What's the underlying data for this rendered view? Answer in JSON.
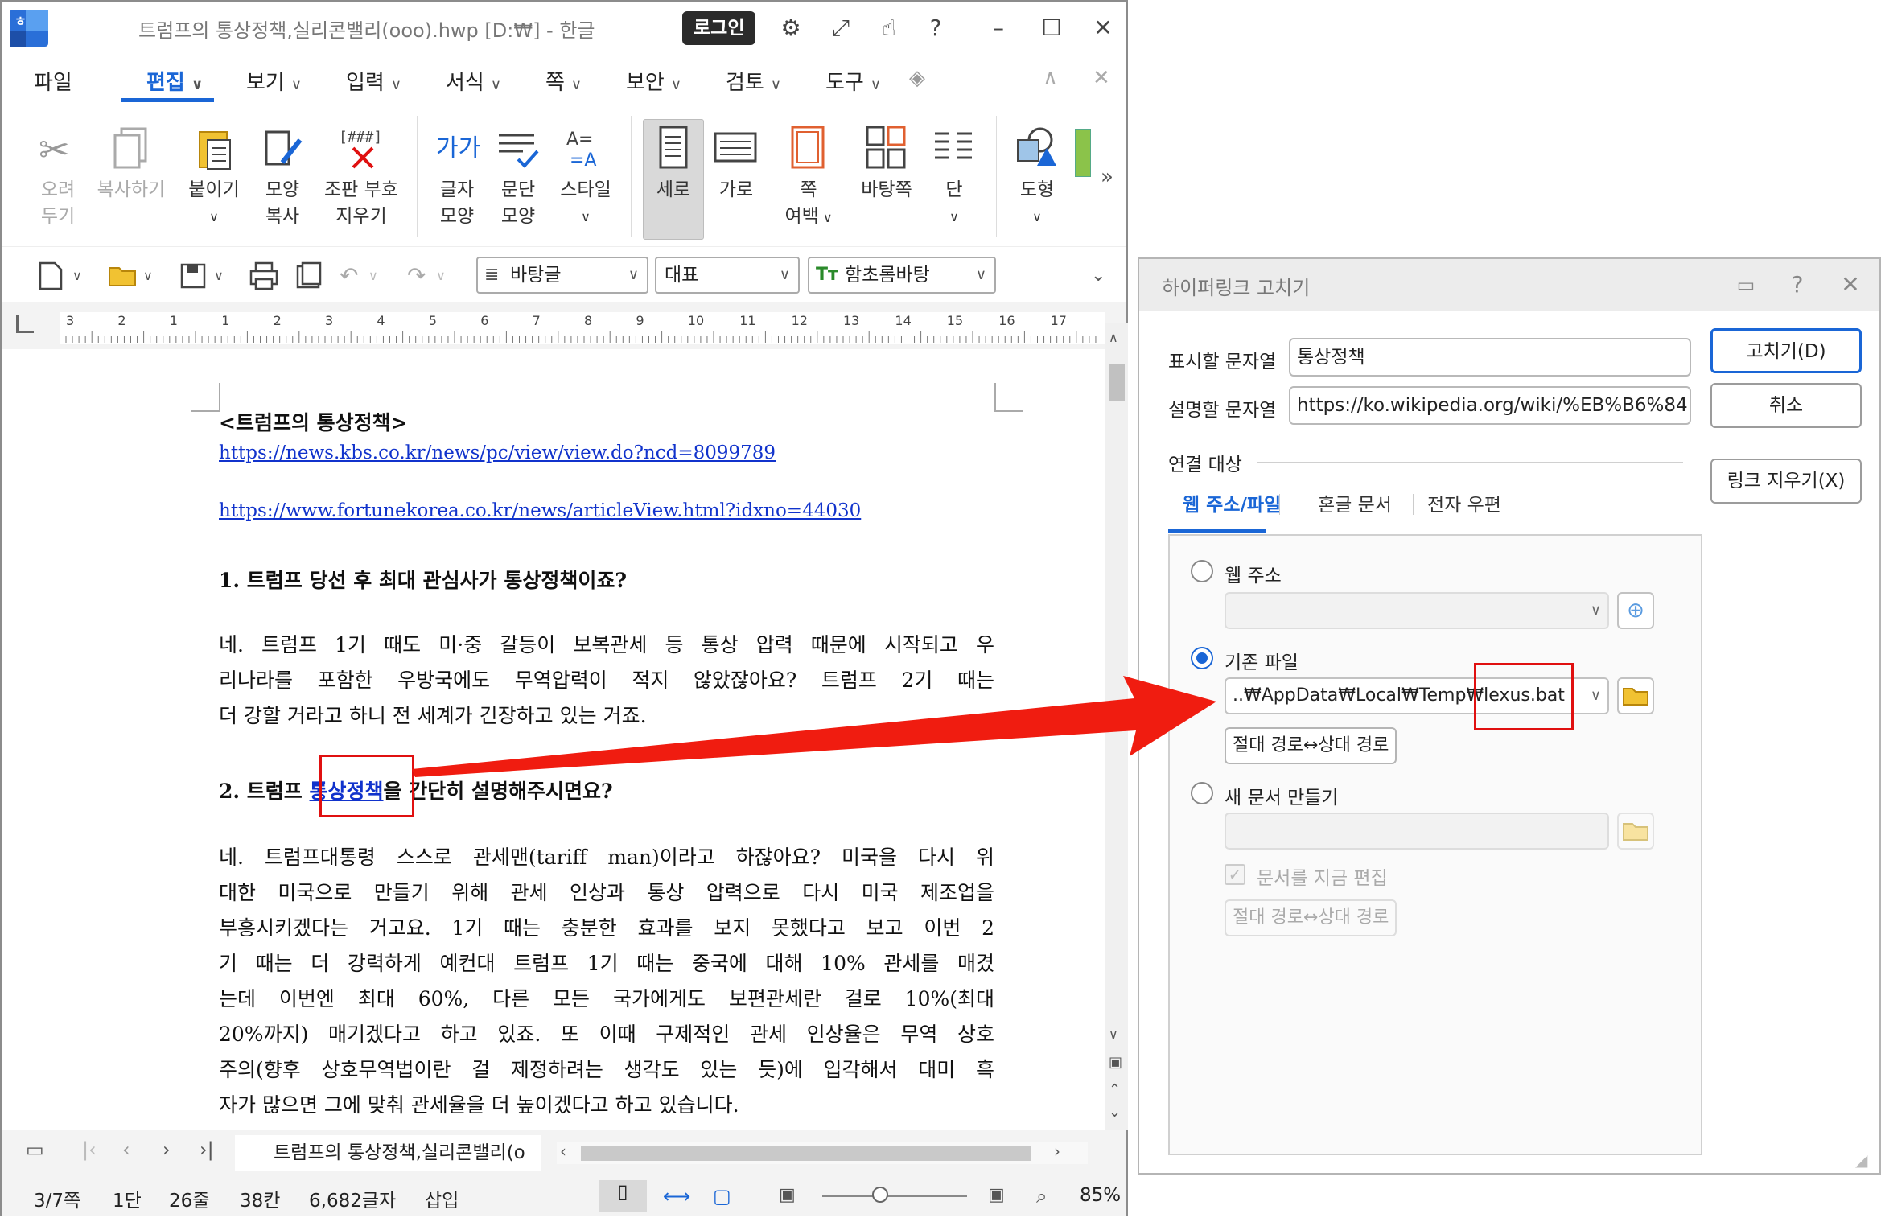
{
  "window": {
    "title": "트럼프의 통상정책,실리콘밸리(ooo).hwp [D:₩] - 한글",
    "login": "로그인"
  },
  "menu": {
    "file": "파일",
    "edit": "편집",
    "view": "보기",
    "input": "입력",
    "format": "서식",
    "page": "쪽",
    "security": "보안",
    "review": "검토",
    "tools": "도구"
  },
  "ribbon": {
    "cut": [
      "오려",
      "두기"
    ],
    "copy": "복사하기",
    "paste": "붙이기",
    "format_copy": [
      "모양",
      "복사"
    ],
    "clear_marks": [
      "조판 부호",
      "지우기"
    ],
    "char_shape": [
      "글자",
      "모양"
    ],
    "para_shape": [
      "문단",
      "모양"
    ],
    "style": "스타일",
    "portrait": "세로",
    "landscape": "가로",
    "margin": [
      "쪽",
      "여백"
    ],
    "background": "바탕쪽",
    "column": "단",
    "shape": "도형",
    "cut_glyph": "✂",
    "clear_glyph": "[###]",
    "char_glyph": "가가"
  },
  "toolbar2": {
    "style_combo": "바탕글",
    "lang_combo": "대표",
    "font_combo": "함초롬바탕"
  },
  "ruler": {
    "ticks": [
      "3",
      "2",
      "1",
      "1",
      "2",
      "3",
      "4",
      "5",
      "6",
      "7",
      "8",
      "9",
      "10",
      "11",
      "12",
      "13",
      "14",
      "15",
      "16",
      "17"
    ]
  },
  "document": {
    "title": "<트럼프의 통상정책>",
    "link1": "https://news.kbs.co.kr/news/pc/view/view.do?ncd=8099789",
    "link2": "https://www.fortunekorea.co.kr/news/articleView.html?idxno=44030",
    "q1": "1. 트럼프 당선 후 최대 관심사가 통상정책이죠?",
    "a1": [
      "네. 트럼프 1기 때도 미·중 갈등이 보복관세 등 통상 압력 때문에 시작되고 우",
      "리나라를 포함한 우방국에도 무역압력이 적지 않았잖아요? 트럼프 2기 때는",
      "더 강할 거라고 하니 전 세계가 긴장하고 있는 거죠."
    ],
    "q2_before": "2. 트럼프 ",
    "q2_link": "통상정책",
    "q2_after": "을 간단히 설명해주시면요?",
    "a2": [
      "네. 트럼프대통령 스스로 관세맨(tariff man)이라고 하잖아요? 미국을 다시 위",
      "대한 미국으로 만들기 위해 관세 인상과 통상 압력으로 다시 미국 제조업을",
      "부흥시키겠다는 거고요. 1기 때는 충분한 효과를 보지 못했다고 보고 이번 2",
      "기 때는 더 강력하게 예컨대 트럼프 1기 때는 중국에 대해 10% 관세를 매겼",
      "는데 이번엔 최대 60%, 다른 모든 국가에게도 보편관세란 걸로 10%(최대",
      "20%까지) 매기겠다고 하고 있죠. 또 이때 구제적인 관세 인상율은 무역 상호",
      "주의(향후 상호무역법이란 걸 제정하려는 생각도 있는 듯)에 입각해서 대미 흑",
      "자가 많으면 그에 맞춰 관세율을 더 높이겠다고 하고 있습니다."
    ]
  },
  "tab": {
    "doc_name": "트럼프의 통상정책,실리콘밸리(o"
  },
  "status": {
    "page": "3/7쪽",
    "column": "1단",
    "line": "26줄",
    "col": "38칸",
    "chars": "6,682글자",
    "mode": "삽입",
    "zoom": "85%",
    "zoom_fraction": 0.4
  },
  "dialog": {
    "title": "하이퍼링크 고치기",
    "display_label": "표시할 문자열",
    "display_value": "통상정책",
    "desc_label": "설명할 문자열",
    "desc_value": "https://ko.wikipedia.org/wiki/%EB%B6%84",
    "fix": "고치기(D)",
    "cancel": "취소",
    "remove_link": "링크 지우기(X)",
    "target_group": "연결 대상",
    "tabs": {
      "web_file": "웹 주소/파일",
      "hwp_doc": "혼글 문서",
      "email": "전자 우편"
    },
    "web_radio": "웹 주소",
    "web_value": "",
    "file_radio": "기존 파일",
    "file_value": "..₩AppData₩Local₩Temp₩lexus.bat",
    "abs_rel": "절대 경로↔상대 경로",
    "new_doc_radio": "새 문서 만들기",
    "new_doc_value": "",
    "edit_now": "문서를 지금 편집",
    "abs_rel2": "절대 경로↔상대 경로",
    "selected_option": "기존 파일"
  },
  "colors": {
    "accent": "#1a66d6",
    "annotation_red": "#e01010",
    "link_blue": "#1133cc"
  }
}
